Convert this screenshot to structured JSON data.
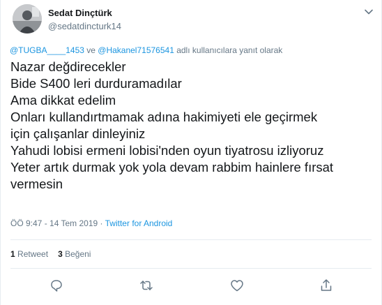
{
  "tweet": {
    "author_name": "Sedat Dinçtürk",
    "author_handle": "@sedatdincturk14",
    "reply_context": {
      "mention_1": "@TUGBA____1453",
      "joiner": " ve ",
      "mention_2": "@Hakanel71576541",
      "suffix": " adlı kullanıcılara yanıt olarak"
    },
    "lines": [
      "Nazar değdirecekler",
      "Bide S400  leri durduramadılar",
      "Ama dikkat edelim",
      "Onları kullandırtmamak adına hakimiyeti ele geçirmek",
      "için çalışanlar dinleyiniz",
      "Yahudi lobisi ermeni lobisi'nden oyun tiyatrosu izliyoruz",
      "Yeter artık durmak yok yola devam rabbim hainlere fırsat",
      "vermesin"
    ],
    "timestamp": "ÖÖ 9:47 - 14 Tem 2019",
    "separator": " · ",
    "source": "Twitter for Android",
    "retweet_count": "1",
    "retweet_label": "Retweet",
    "like_count": "3",
    "like_label": "Beğeni"
  },
  "icons": {
    "more": "chevron-down-icon",
    "reply": "reply-icon",
    "retweet": "retweet-icon",
    "like": "heart-icon",
    "share": "share-icon"
  },
  "colors": {
    "link": "#1b95e0",
    "secondary_text": "#657786",
    "primary_text": "#14171a",
    "divider": "#e6ecf0"
  }
}
